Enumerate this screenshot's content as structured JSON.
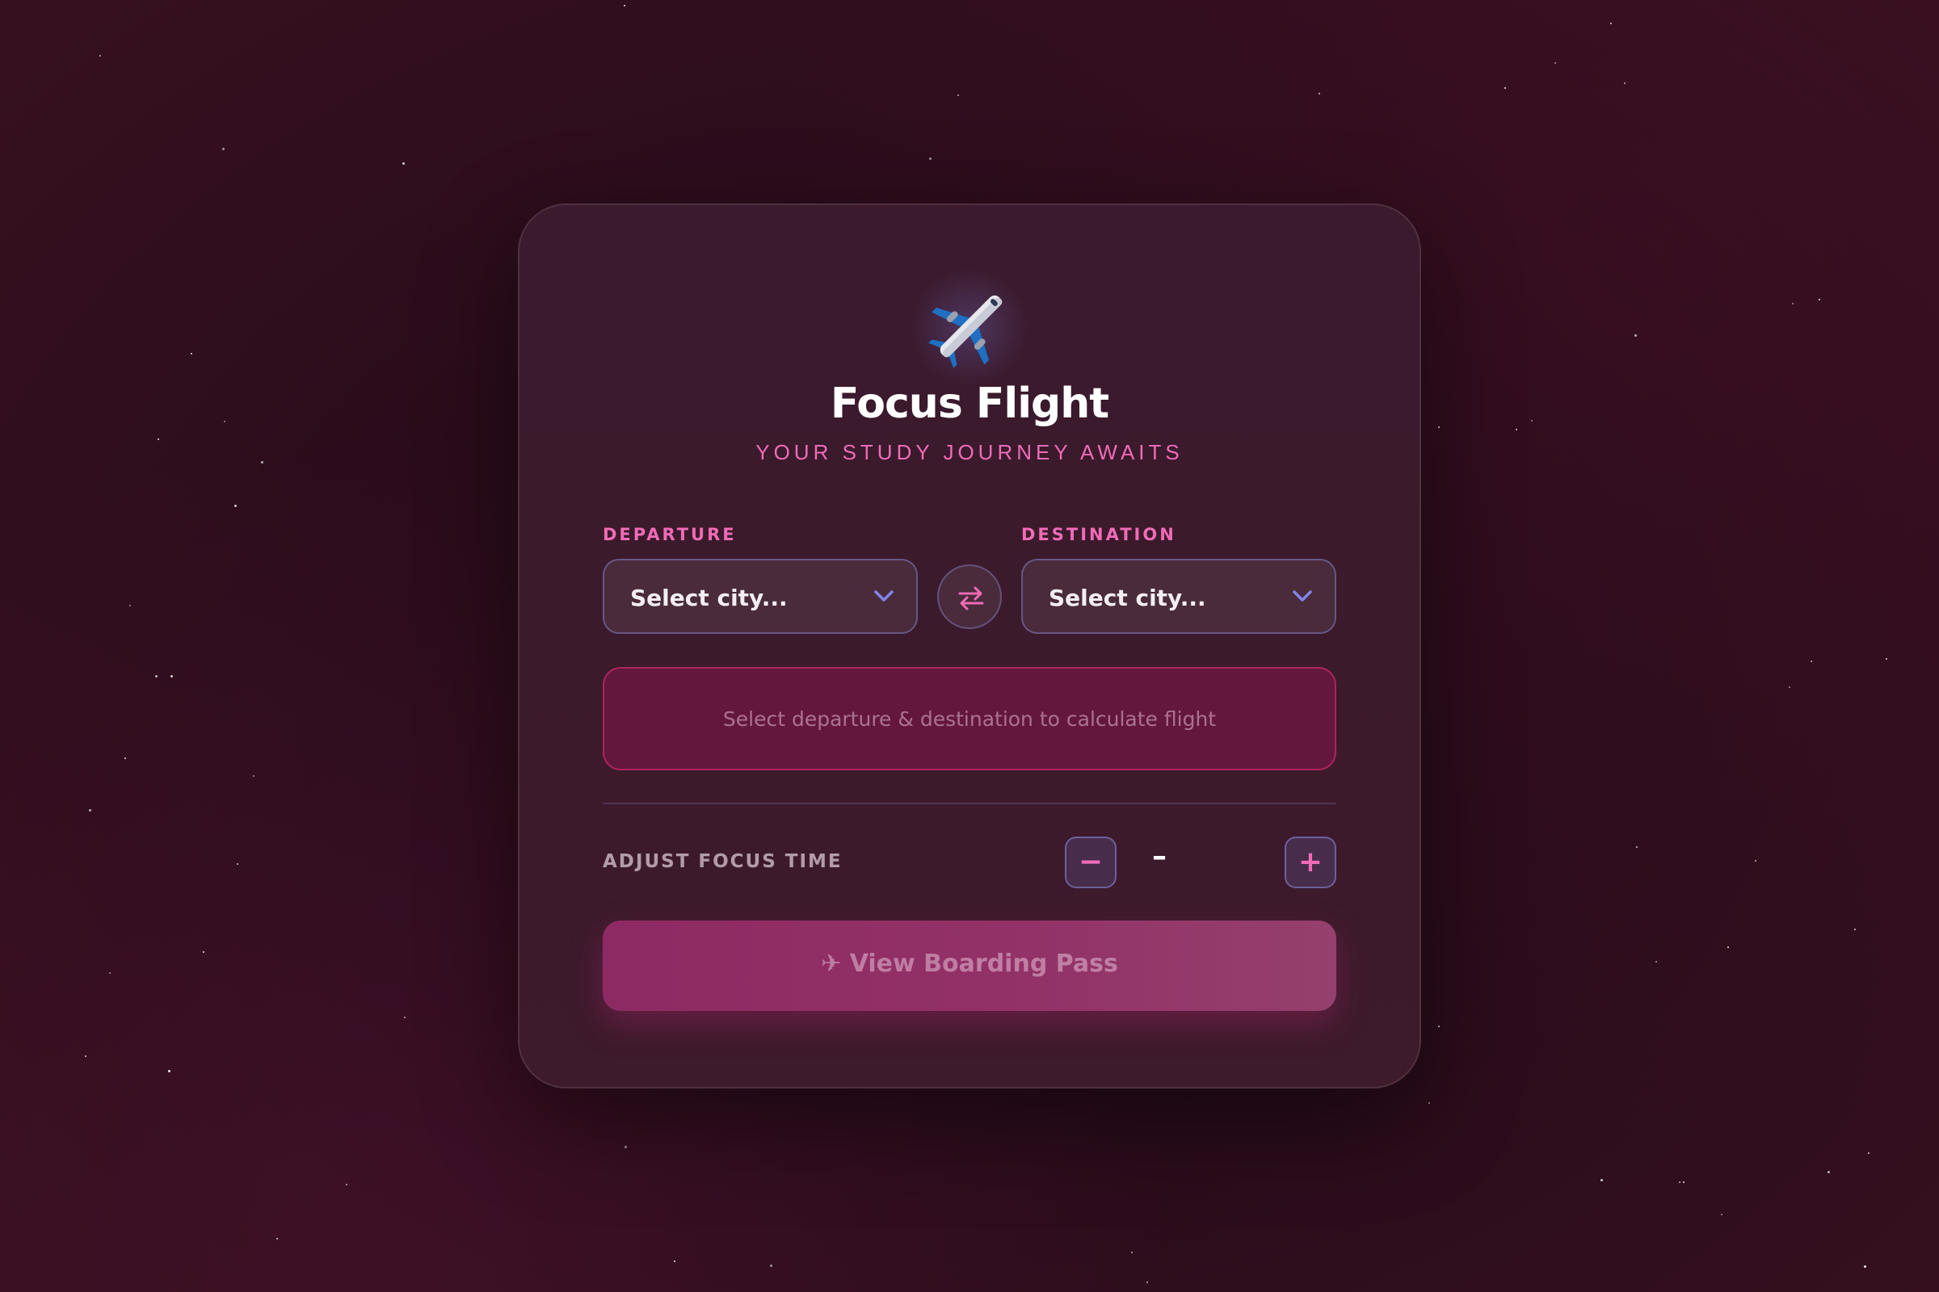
{
  "app": {
    "title": "Focus Flight",
    "subtitle": "YOUR STUDY JOURNEY AWAITS",
    "logo_icon": "airplane-icon"
  },
  "departure": {
    "label": "DEPARTURE",
    "value": "Select city..."
  },
  "destination": {
    "label": "DESTINATION",
    "value": "Select city..."
  },
  "swap": {
    "icon": "swap-arrows-icon"
  },
  "flight_info": {
    "message": "Select departure & destination to calculate flight"
  },
  "focus_time": {
    "label": "ADJUST FOCUS TIME",
    "decrement_label": "−",
    "increment_label": "+",
    "value": "–"
  },
  "boarding_pass": {
    "label": "✈ View Boarding Pass"
  },
  "colors": {
    "accent_pink": "#f06bb6",
    "chevron_blue": "#7f86e6",
    "background": "#2a0c1c",
    "card": "#3b1a2c"
  }
}
